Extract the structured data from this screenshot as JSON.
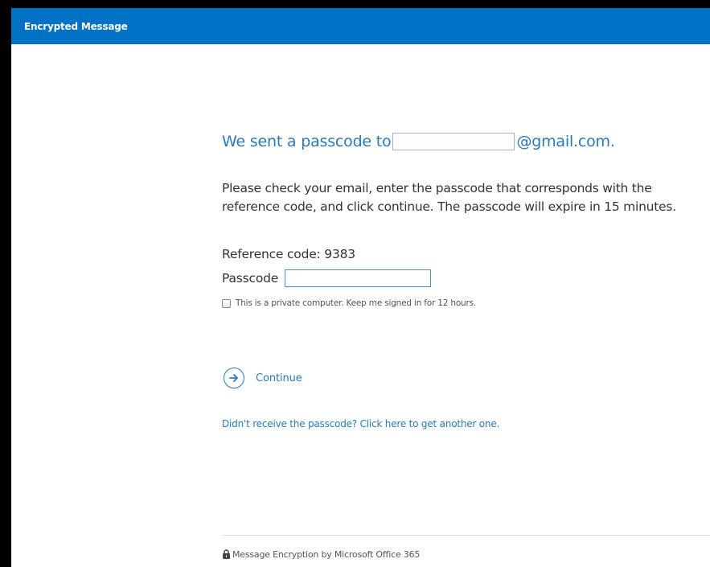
{
  "header": {
    "title": "Encrypted Message"
  },
  "main": {
    "heading_prefix": "We sent a passcode to",
    "heading_suffix": "@gmail.com.",
    "email_value": "",
    "instructions": "Please check your email, enter the passcode that corresponds with the reference code, and click continue. The passcode will expire in 15 minutes.",
    "reference_code": "Reference code: 9383",
    "passcode_label": "Passcode",
    "passcode_value": "",
    "keep_signed_in_label": "This is a private computer. Keep me signed in for 12 hours.",
    "keep_signed_in_checked": false,
    "continue_label": "Continue",
    "resend_link": "Didn't receive the passcode? Click here to get another one."
  },
  "footer": {
    "text": "Message Encryption by Microsoft Office 365",
    "icon": "lock-icon"
  },
  "colors": {
    "header_bg": "#0072c6",
    "accent": "#2a7ab7",
    "text": "#333333"
  },
  "icons": {
    "continue": "arrow-right-circle-icon",
    "footer": "lock-icon"
  }
}
